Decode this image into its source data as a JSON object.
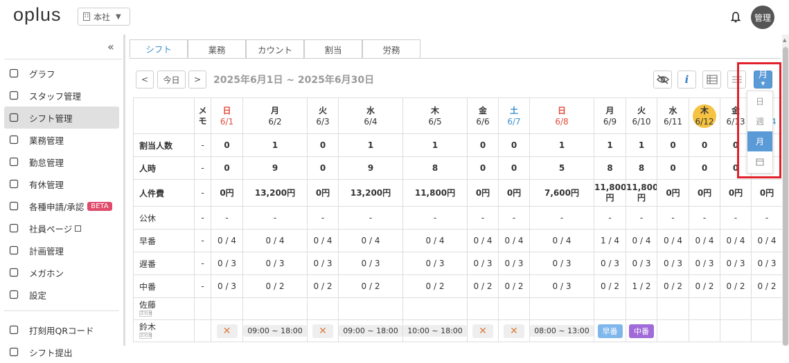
{
  "header": {
    "logo": "oplus",
    "office": "本社",
    "avatar": "管理"
  },
  "sidebar": {
    "items": [
      {
        "label": "グラフ",
        "icon": "chart-icon"
      },
      {
        "label": "スタッフ管理",
        "icon": "person-icon"
      },
      {
        "label": "シフト管理",
        "icon": "calendar-check-icon",
        "active": true
      },
      {
        "label": "業務管理",
        "icon": "calendar-task-icon"
      },
      {
        "label": "勤怠管理",
        "icon": "clock-icon"
      },
      {
        "label": "有休管理",
        "icon": "calendar-x-icon"
      },
      {
        "label": "各種申請/承認",
        "icon": "request-icon",
        "badge": "BETA"
      },
      {
        "label": "社員ページ",
        "icon": "timer-icon",
        "external": true
      },
      {
        "label": "計画管理",
        "icon": "plan-icon"
      },
      {
        "label": "メガホン",
        "icon": "megaphone-icon"
      },
      {
        "label": "設定",
        "icon": "gear-icon"
      }
    ],
    "items2": [
      {
        "label": "打刻用QRコード",
        "icon": "qr-icon"
      },
      {
        "label": "シフト提出",
        "icon": "submit-icon"
      }
    ]
  },
  "tabs": [
    "シフト",
    "業務",
    "カウント",
    "割当",
    "労務"
  ],
  "toolbar": {
    "today": "今日",
    "prev": "<",
    "next": ">",
    "range": "2025年6月1日 ~ 2025年6月30日",
    "info": "i",
    "view": "月"
  },
  "dropdown": {
    "options": [
      "日",
      "週",
      "月"
    ],
    "selected": "月"
  },
  "table": {
    "memo_header": "メモ",
    "days": [
      {
        "wd": "日",
        "d": "6/1",
        "type": "sun"
      },
      {
        "wd": "月",
        "d": "6/2"
      },
      {
        "wd": "火",
        "d": "6/3"
      },
      {
        "wd": "水",
        "d": "6/4"
      },
      {
        "wd": "木",
        "d": "6/5"
      },
      {
        "wd": "金",
        "d": "6/6"
      },
      {
        "wd": "土",
        "d": "6/7",
        "type": "sat"
      },
      {
        "wd": "日",
        "d": "6/8",
        "type": "sun"
      },
      {
        "wd": "月",
        "d": "6/9"
      },
      {
        "wd": "火",
        "d": "6/10"
      },
      {
        "wd": "水",
        "d": "6/11"
      },
      {
        "wd": "木",
        "d": "6/12",
        "type": "today"
      },
      {
        "wd": "金",
        "d": "6/13"
      },
      {
        "wd": "土",
        "d": "6/14",
        "type": "sat"
      }
    ],
    "rows": [
      {
        "label": "割当人数",
        "bold": true,
        "memo": "-",
        "cells": [
          "0",
          "1",
          "0",
          "1",
          "1",
          "0",
          "0",
          "1",
          "1",
          "1",
          "0",
          "0",
          "0",
          "0"
        ]
      },
      {
        "label": "人時",
        "bold": true,
        "memo": "-",
        "cells": [
          "0",
          "9",
          "0",
          "9",
          "8",
          "0",
          "0",
          "5",
          "8",
          "8",
          "0",
          "0",
          "0",
          "0"
        ]
      },
      {
        "label": "人件費",
        "bold": true,
        "memo": "-",
        "cells": [
          "0円",
          "13,200円",
          "0円",
          "13,200円",
          "11,800円",
          "0円",
          "0円",
          "7,600円",
          "11,800円",
          "11,800円",
          "0円",
          "0円",
          "0円",
          "0円"
        ]
      },
      {
        "label": "公休",
        "bold": false,
        "memo": "-",
        "muted": true,
        "cells": [
          "-",
          "-",
          "-",
          "-",
          "-",
          "-",
          "-",
          "-",
          "-",
          "-",
          "-",
          "-",
          "-",
          "-"
        ]
      },
      {
        "label": "早番",
        "bold": false,
        "memo": "-",
        "orange": true,
        "cells": [
          "0 / 4",
          "0 / 4",
          "0 / 4",
          "0 / 4",
          "0 / 4",
          "0 / 4",
          "0 / 4",
          "0 / 4",
          "1 / 4",
          "0 / 4",
          "0 / 4",
          "0 / 4",
          "0 / 4",
          "0 / 4"
        ]
      },
      {
        "label": "遅番",
        "bold": false,
        "memo": "-",
        "orange": true,
        "cells": [
          "0 / 3",
          "0 / 3",
          "0 / 3",
          "0 / 3",
          "0 / 3",
          "0 / 3",
          "0 / 3",
          "0 / 3",
          "0 / 3",
          "0 / 3",
          "0 / 3",
          "0 / 3",
          "0 / 3",
          "0 / 3"
        ]
      },
      {
        "label": "中番",
        "bold": false,
        "memo": "-",
        "orange": true,
        "cells": [
          "0 / 3",
          "0 / 2",
          "0 / 2",
          "0 / 2",
          "0 / 2",
          "0 / 2",
          "0 / 2",
          "0 / 3",
          "0 / 2",
          "1 / 2",
          "0 / 2",
          "0 / 2",
          "0 / 2",
          "0 / 2"
        ]
      }
    ],
    "staff": [
      {
        "name": "佐藤",
        "role": "正社員",
        "cells": [
          "",
          "",
          "",
          "",
          "",
          "",
          "",
          "",
          "",
          "",
          "",
          "",
          "",
          ""
        ]
      },
      {
        "name": "鈴木",
        "role": "正社員",
        "cells": [
          "x",
          "09:00 ~ 18:00",
          "x",
          "09:00 ~ 18:00",
          "10:00 ~ 18:00",
          "x",
          "x",
          "08:00 ~ 13:00",
          "早番",
          "中番",
          "",
          "",
          "",
          ""
        ]
      }
    ]
  }
}
